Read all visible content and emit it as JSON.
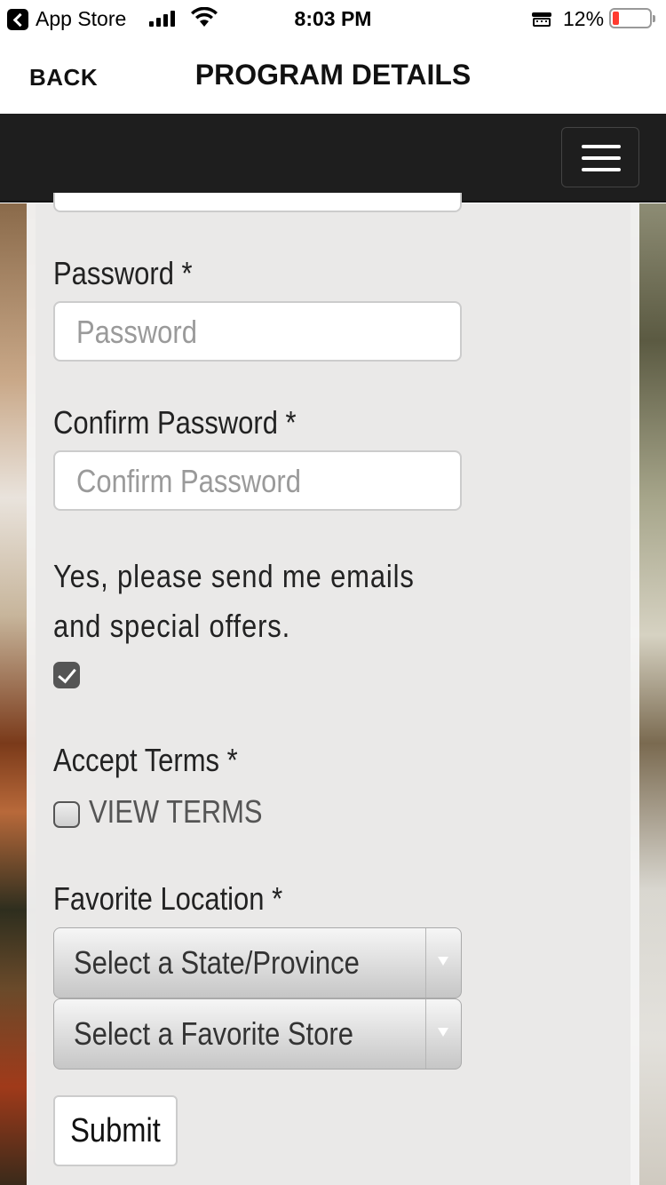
{
  "status_bar": {
    "back_app": "App Store",
    "time": "8:03 PM",
    "battery_pct": "12%"
  },
  "nav": {
    "back_label": "BACK",
    "title": "PROGRAM DETAILS"
  },
  "form": {
    "password": {
      "label": "Password *",
      "placeholder": "Password"
    },
    "confirm_password": {
      "label": "Confirm Password *",
      "placeholder": "Confirm Password"
    },
    "optin": {
      "line1": "Yes, please send me emails",
      "line2": "and special offers.",
      "checked": true
    },
    "terms": {
      "label": "Accept Terms *",
      "link": "VIEW TERMS",
      "checked": false
    },
    "favorite_location": {
      "label": "Favorite Location *",
      "state_select": "Select a State/Province",
      "store_select": "Select a Favorite Store"
    },
    "submit_label": "Submit"
  },
  "colors": {
    "header_bg": "#1e1e1e",
    "battery_low": "#ff3b30"
  }
}
